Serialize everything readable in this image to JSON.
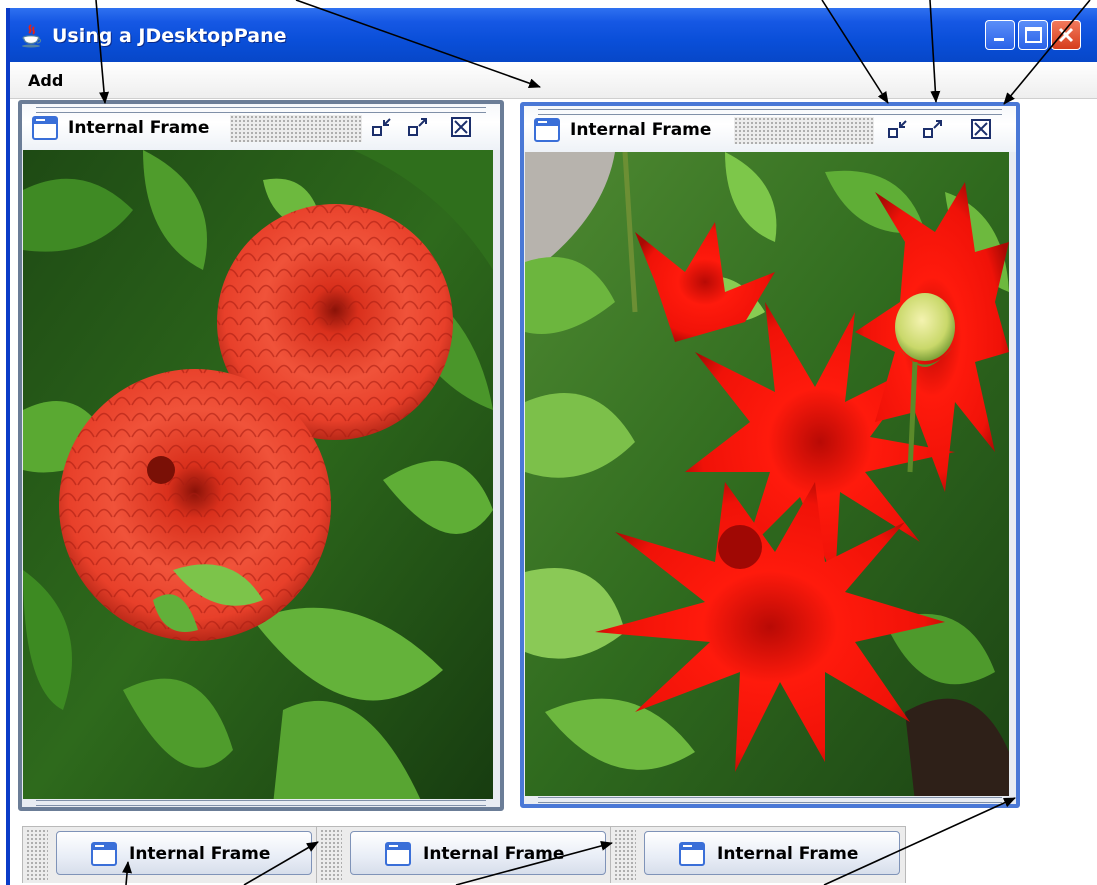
{
  "window": {
    "title": "Using a JDesktopPane",
    "controls": {
      "minimize": "minimize-icon",
      "maximize": "maximize-icon",
      "close": "close-icon"
    }
  },
  "menubar": {
    "items": [
      {
        "label": "Add"
      }
    ]
  },
  "internal_frames": [
    {
      "title": "Internal Frame",
      "state": "inactive",
      "content": "photo of two orange-red pompon dahlias among green leaves"
    },
    {
      "title": "Internal Frame",
      "state": "active",
      "content": "photo of a bright red cactus dahlia with a closed bud"
    }
  ],
  "iconified_frames": [
    {
      "label": "Internal Frame"
    },
    {
      "label": "Internal Frame"
    },
    {
      "label": "Internal Frame"
    }
  ],
  "colors": {
    "titlebar_blue": "#0a4fd9",
    "active_frame_border": "#4a78d6",
    "inactive_frame_border": "#6b7d97",
    "close_button_red": "#d63d1c"
  }
}
